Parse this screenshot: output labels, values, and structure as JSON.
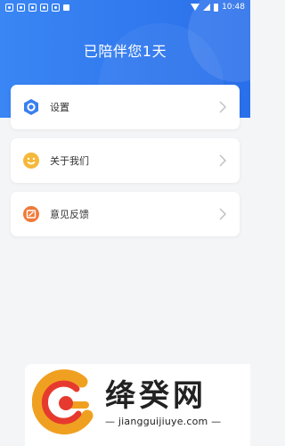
{
  "status_bar": {
    "time": "10:48"
  },
  "header": {
    "title": "已陪伴您1天"
  },
  "menu": {
    "items": [
      {
        "label": "设置",
        "icon": "hexagon-settings-icon",
        "color": "#3a7ff0"
      },
      {
        "label": "关于我们",
        "icon": "smiley-icon",
        "color": "#f5b83a"
      },
      {
        "label": "意见反馈",
        "icon": "feedback-icon",
        "color": "#f07a3a"
      }
    ]
  },
  "watermark": {
    "title": "绛癸网",
    "url": "— jiangguijiuye.com —"
  },
  "colors": {
    "primary": "#2f78ef",
    "background": "#f4f5f7"
  }
}
